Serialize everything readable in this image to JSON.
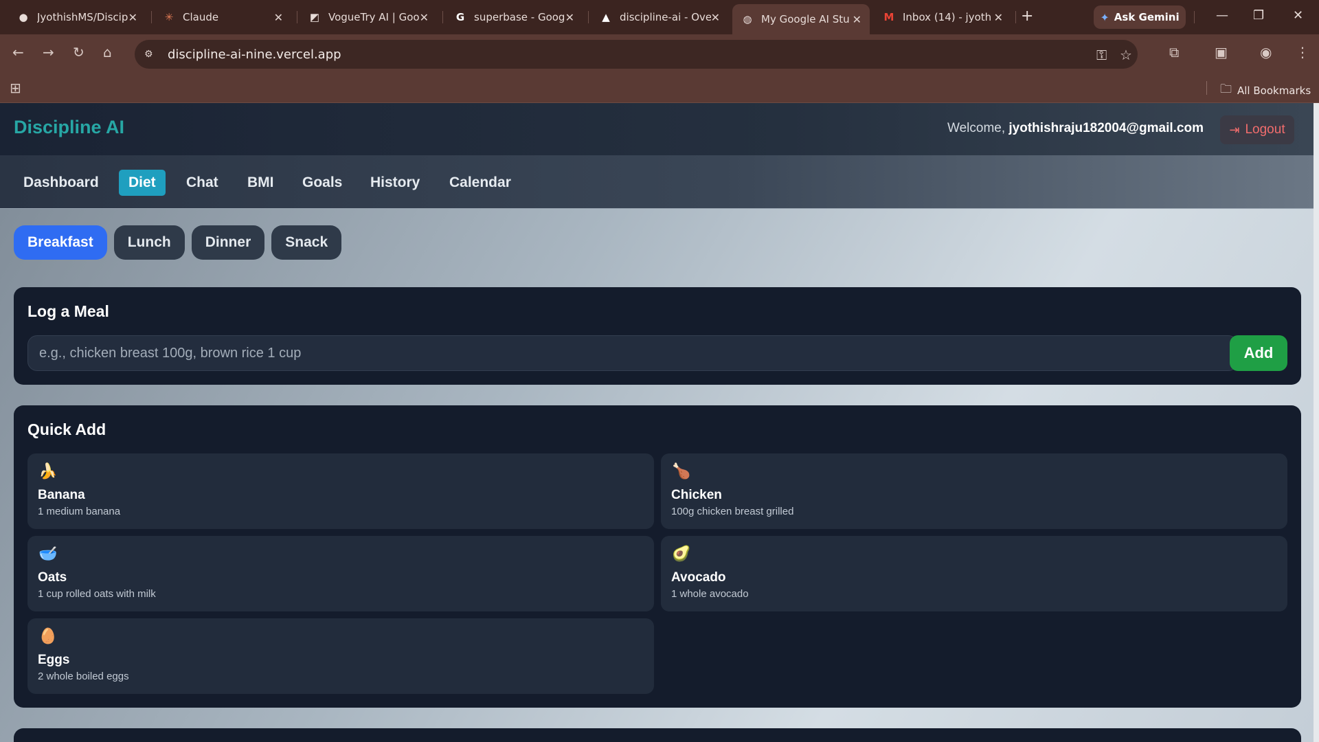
{
  "browser": {
    "tabs": [
      {
        "title": "JyothishMS/Discip",
        "icon": "github-icon",
        "glyph": "●"
      },
      {
        "title": "Claude",
        "icon": "claude-icon",
        "glyph": "✳"
      },
      {
        "title": "VogueTry AI | Goo",
        "icon": "page-icon",
        "glyph": "◩"
      },
      {
        "title": "superbase - Goog",
        "icon": "google-icon",
        "glyph": "G"
      },
      {
        "title": "discipline-ai - Ove",
        "icon": "vercel-icon",
        "glyph": "▲"
      },
      {
        "title": "My Google AI Stu",
        "icon": "globe-icon",
        "glyph": "◍"
      },
      {
        "title": "Inbox (14) - jyoth",
        "icon": "gmail-icon",
        "glyph": "M"
      }
    ],
    "new_tab": "+",
    "ask_gemini": "Ask Gemini",
    "url": "discipline-ai-nine.vercel.app",
    "all_bookmarks": "All Bookmarks"
  },
  "app": {
    "brand": "Discipline AI",
    "welcome_prefix": "Welcome,",
    "user_email": "jyothishraju182004@gmail.com",
    "logout": "Logout",
    "nav": [
      "Dashboard",
      "Diet",
      "Chat",
      "BMI",
      "Goals",
      "History",
      "Calendar"
    ],
    "nav_active": "Diet",
    "meals": [
      "Breakfast",
      "Lunch",
      "Dinner",
      "Snack"
    ],
    "meal_active": "Breakfast",
    "log_meal": {
      "title": "Log a Meal",
      "placeholder": "e.g., chicken breast 100g, brown rice 1 cup",
      "add": "Add"
    },
    "quick_add": {
      "title": "Quick Add",
      "items": [
        {
          "emoji": "🍌",
          "name": "Banana",
          "desc": "1 medium banana"
        },
        {
          "emoji": "🍗",
          "name": "Chicken",
          "desc": "100g chicken breast grilled"
        },
        {
          "emoji": "🥣",
          "name": "Oats",
          "desc": "1 cup rolled oats with milk"
        },
        {
          "emoji": "🥑",
          "name": "Avocado",
          "desc": "1 whole avocado"
        },
        {
          "emoji": "🥚",
          "name": "Eggs",
          "desc": "2 whole boiled eggs"
        }
      ]
    }
  }
}
